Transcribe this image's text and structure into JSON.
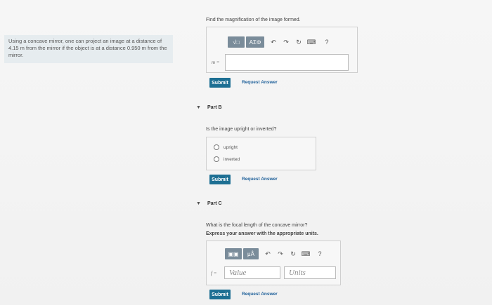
{
  "problem": {
    "text": "Using a concave mirror, one can project an image at a distance of 4.15 m from the mirror if the object is at a distance 0.950 m from the mirror."
  },
  "partA": {
    "question": "Find the magnification of the image formed.",
    "toolbar": {
      "sqrt_label": "√□",
      "greek_label": "ΑΣΦ",
      "help": "?"
    },
    "input_label": "m ="
  },
  "partB": {
    "header": "Part B",
    "question": "Is the image upright or inverted?",
    "options": [
      "upright",
      "inverted"
    ]
  },
  "partC": {
    "header": "Part C",
    "question": "What is the focal length of the concave mirror?",
    "instruction": "Express your answer with the appropriate units.",
    "input_label": "f =",
    "value_placeholder": "Value",
    "units_placeholder": "Units",
    "help": "?"
  },
  "actions": {
    "submit": "Submit",
    "request_answer": "Request Answer"
  }
}
